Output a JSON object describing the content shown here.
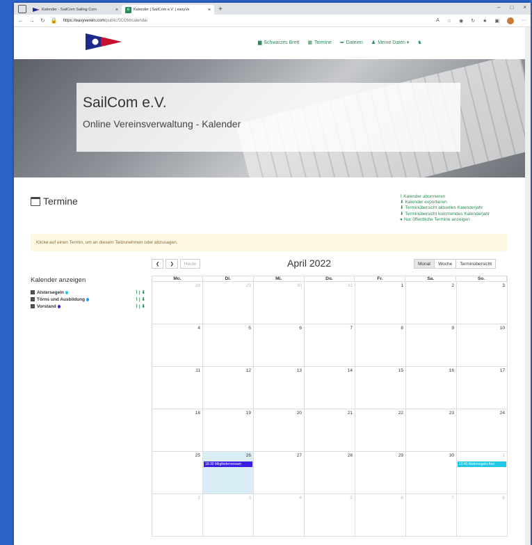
{
  "browser": {
    "tabs": [
      {
        "label": "Kalender - SailCom Sailing Com",
        "close": "×"
      },
      {
        "label": "Kalender | SailCom e.V. | easyVe",
        "close": "×"
      }
    ],
    "new_tab": "+",
    "window_controls": [
      "–",
      "□",
      "×"
    ],
    "url_host": "https://easyverein.com",
    "url_path": "/public/SCOM/calendar"
  },
  "nav": {
    "items": [
      "Schwarzes Brett",
      "Termine",
      "Dateien",
      "Meine Daten ▾"
    ]
  },
  "hero": {
    "title": "SailCom e.V.",
    "subtitle": "Online Vereinsverwaltung - Kalender"
  },
  "page": {
    "heading": "Termine",
    "links": [
      "Kalender abonnieren",
      "Kalender exportieren",
      "Terminübersicht aktuelles Kalenderjahr",
      "Terminübersicht kommendes Kalenderjahr",
      "Nur öffentliche Termine anzeigen"
    ],
    "alert": "Klicke auf einen Termin, um an diesem Teilzunehmen oder abzusagen."
  },
  "sidebar": {
    "heading": "Kalender anzeigen",
    "calendars": [
      {
        "name": "Alstersegeln",
        "color": "#1fc8e8",
        "actions": "⌇ | ⬇"
      },
      {
        "name": "Törns und Ausbildung",
        "color": "#1fa0e8",
        "actions": "⌇ | ⬇"
      },
      {
        "name": "Vorstand",
        "color": "#3b1ee6",
        "actions": "⌇ | ⬇"
      }
    ]
  },
  "calendar": {
    "prev": "❮",
    "next": "❯",
    "today": "Heute",
    "title": "April 2022",
    "views": [
      "Monat",
      "Woche",
      "Terminübersicht"
    ],
    "weekdays": [
      "Mo.",
      "Di.",
      "Mi.",
      "Do.",
      "Fr.",
      "Sa.",
      "So."
    ],
    "weeks": [
      [
        "28",
        "29",
        "30",
        "31",
        "1",
        "2",
        "3"
      ],
      [
        "4",
        "5",
        "6",
        "7",
        "8",
        "9",
        "10"
      ],
      [
        "11",
        "12",
        "13",
        "14",
        "15",
        "16",
        "17"
      ],
      [
        "18",
        "19",
        "20",
        "21",
        "22",
        "23",
        "24"
      ],
      [
        "25",
        "26",
        "27",
        "28",
        "29",
        "30",
        "1"
      ],
      [
        "2",
        "3",
        "4",
        "5",
        "6",
        "7",
        "8"
      ]
    ],
    "events": [
      {
        "text": "18:30 Mitgliederversam",
        "color": "#3b1ee6"
      },
      {
        "text": "10:45 Alstersegeln Ans",
        "color": "#1fc8e8"
      }
    ]
  }
}
